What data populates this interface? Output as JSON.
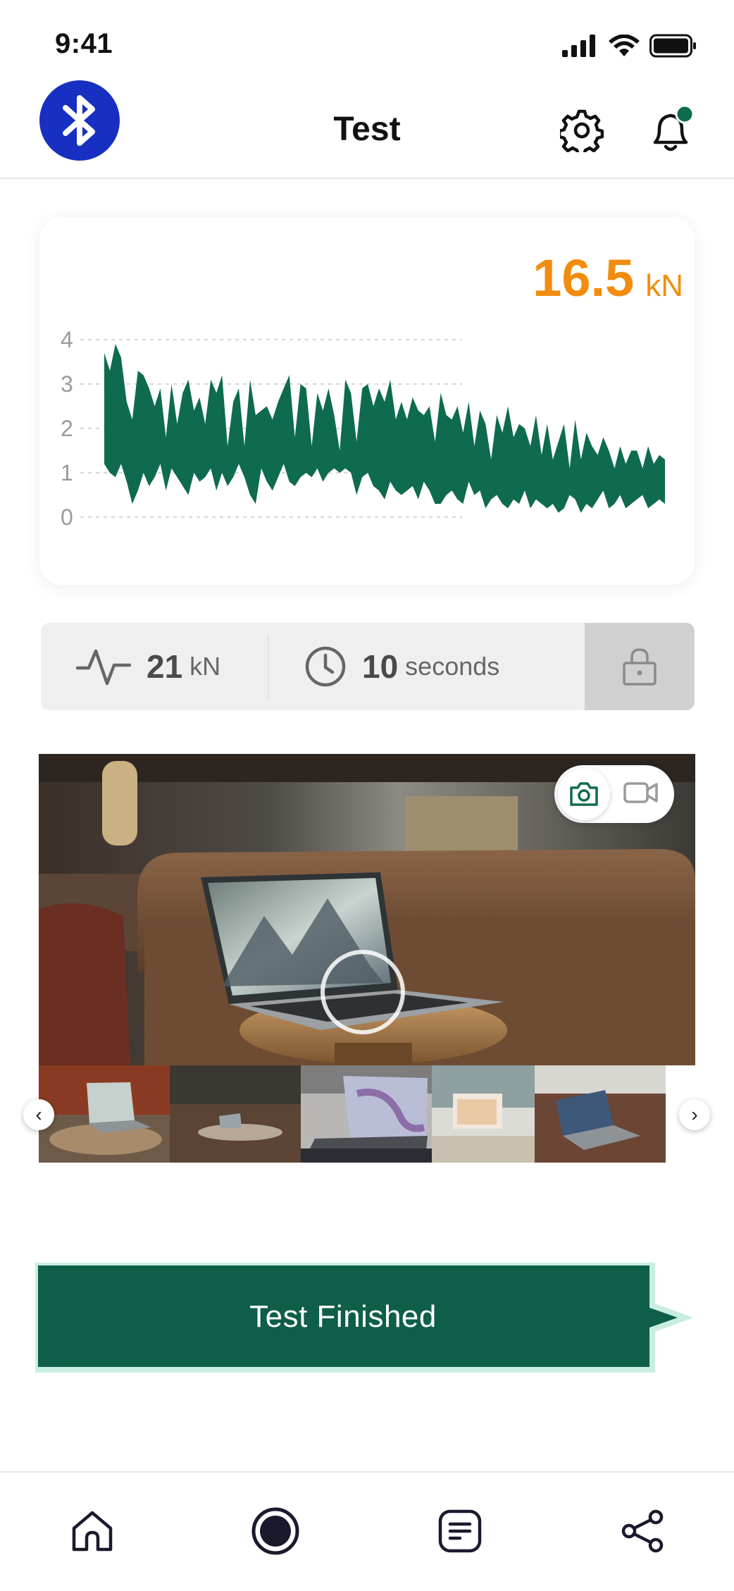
{
  "status_bar": {
    "time": "9:41"
  },
  "header": {
    "title": "Test",
    "bluetooth_icon": "bluetooth-icon",
    "settings_icon": "gear-icon",
    "notification_icon": "bell-icon",
    "notification_dot_color": "#0e6b4f"
  },
  "live_reading": {
    "value": "16.5",
    "unit": "kN",
    "color": "#f28c0f"
  },
  "chart_data": {
    "type": "area",
    "yticks": [
      "4",
      "3",
      "2",
      "1",
      "0"
    ],
    "ylim": [
      0,
      4
    ],
    "grid": true,
    "color": "#0e6b4f",
    "upper": [
      3.7,
      3.3,
      3.9,
      3.6,
      2.6,
      2.2,
      3.3,
      3.2,
      2.9,
      2.5,
      2.9,
      1.8,
      3.0,
      2.1,
      2.8,
      3.1,
      2.4,
      2.7,
      2.1,
      3.1,
      2.8,
      3.2,
      1.6,
      2.6,
      2.9,
      1.6,
      3.1,
      2.3,
      2.4,
      2.5,
      2.2,
      2.6,
      2.9,
      3.2,
      1.8,
      3.0,
      2.9,
      1.6,
      2.8,
      2.4,
      2.9,
      2.3,
      1.5,
      3.1,
      2.8,
      1.7,
      2.9,
      3.0,
      2.5,
      2.9,
      2.6,
      3.1,
      2.2,
      2.6,
      2.2,
      2.7,
      2.4,
      2.3,
      2.5,
      1.7,
      2.8,
      2.3,
      2.2,
      2.5,
      1.9,
      2.6,
      1.6,
      2.4,
      2.1,
      1.3,
      2.3,
      1.9,
      2.5,
      1.8,
      2.1,
      2.0,
      1.6,
      2.3,
      1.4,
      2.1,
      1.3,
      1.7,
      2.1,
      1.1,
      2.2,
      1.3,
      1.9,
      1.6,
      1.4,
      1.8,
      1.5,
      1.1,
      1.6,
      1.2,
      1.5,
      1.5,
      1.1,
      1.6,
      1.2,
      1.4,
      1.3
    ],
    "lower": [
      1.2,
      1.0,
      0.9,
      1.2,
      0.8,
      0.3,
      0.6,
      1.0,
      0.7,
      0.9,
      1.2,
      0.6,
      1.1,
      0.9,
      0.7,
      0.5,
      1.0,
      0.8,
      0.9,
      1.1,
      0.6,
      1.0,
      0.7,
      0.9,
      1.2,
      0.9,
      0.5,
      0.3,
      1.1,
      0.8,
      0.6,
      0.9,
      1.2,
      0.8,
      0.7,
      0.9,
      1.0,
      0.9,
      1.1,
      0.8,
      1.0,
      1.1,
      1.0,
      1.1,
      1.0,
      0.5,
      0.9,
      1.0,
      0.7,
      0.6,
      0.4,
      0.8,
      0.6,
      0.5,
      0.6,
      0.7,
      0.4,
      0.8,
      0.6,
      0.3,
      0.3,
      0.5,
      0.6,
      0.4,
      0.3,
      0.8,
      0.5,
      0.6,
      0.2,
      0.4,
      0.5,
      0.3,
      0.2,
      0.4,
      0.3,
      0.6,
      0.2,
      0.4,
      0.3,
      0.2,
      0.3,
      0.1,
      0.2,
      0.5,
      0.4,
      0.1,
      0.3,
      0.2,
      0.4,
      0.6,
      0.2,
      0.3,
      0.5,
      0.2,
      0.3,
      0.4,
      0.5,
      0.2,
      0.3,
      0.4,
      0.3
    ]
  },
  "stats": {
    "peak_value": "21",
    "peak_unit": "kN",
    "peak_icon": "pulse-icon",
    "duration_value": "10",
    "duration_unit": "seconds",
    "duration_icon": "clock-icon",
    "lock_icon": "lock-icon"
  },
  "camera": {
    "photo_mode_icon": "camera-icon",
    "video_mode_icon": "video-icon",
    "prev_icon": "chevron-left-icon",
    "next_icon": "chevron-right-icon",
    "prev_glyph": "‹",
    "next_glyph": "›"
  },
  "finish_banner": {
    "label": "Test Finished",
    "color": "#0e5e4a",
    "border_color": "#c9eee0"
  },
  "tabbar": {
    "items": [
      {
        "name": "home",
        "icon": "home-icon"
      },
      {
        "name": "record",
        "icon": "record-icon"
      },
      {
        "name": "reports",
        "icon": "document-icon"
      },
      {
        "name": "share",
        "icon": "share-icon"
      }
    ]
  }
}
